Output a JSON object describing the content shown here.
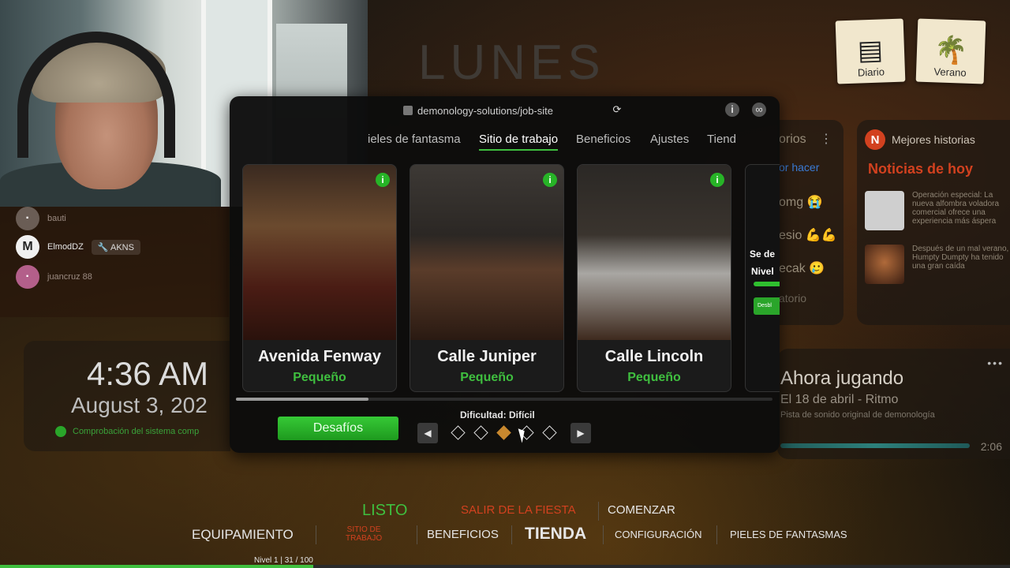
{
  "day_title": "LUNES",
  "top_cards": [
    {
      "label": "Diario",
      "icon": "newspaper-icon",
      "glyph": "▤"
    },
    {
      "label": "Verano",
      "icon": "palm-tree-icon",
      "glyph": "🌴"
    }
  ],
  "chat": {
    "messages": [
      {
        "name": "bauti",
        "avatar": "·",
        "badge": ""
      },
      {
        "name": "ElmodDZ",
        "avatar": "M",
        "badge": "🔧 AKNS"
      },
      {
        "name": "juancruz 88",
        "avatar": "·",
        "badge": ""
      }
    ]
  },
  "clock": {
    "time": "4:36 AM",
    "date": "August 3, 202",
    "status": "Comprobación del sistema comp"
  },
  "browser": {
    "url": "demonology-solutions/job-site",
    "tabs": [
      "ieles de fantasma",
      "Sitio de trabajo",
      "Beneficios",
      "Ajustes",
      "Tiend"
    ],
    "active_tab": "Sitio de trabajo"
  },
  "job_sites": [
    {
      "name": "Avenida Fenway",
      "size": "Pequeño"
    },
    {
      "name": "Calle Juniper",
      "size": "Pequeño"
    },
    {
      "name": "Calle Lincoln",
      "size": "Pequeño"
    }
  ],
  "partial_card": {
    "line1": "Se de",
    "line2": "Nivel",
    "button": "Desbl"
  },
  "challenges_label": "Desafíos",
  "difficulty_label": "Dificultad: Difícil",
  "difficulty": {
    "selected_index": 2,
    "levels": 5
  },
  "stories_panel": {
    "lines": [
      "orios",
      "or hacer",
      "omg 😭",
      "esio 💪💪",
      "ecak 🥲",
      "atorio"
    ]
  },
  "news": {
    "header": "Mejores historias",
    "title": "Noticias de hoy",
    "items": [
      {
        "text": "Operación especial: La nueva alfombra voladora comercial ofrece una experiencia más áspera"
      },
      {
        "text": "Después de un mal verano, Humpty Dumpty ha tenido una gran caída"
      }
    ]
  },
  "now_playing": {
    "title": "Ahora jugando",
    "track": "El 18 de abril - Ritmo",
    "description": "Pista de sonido original de demonología",
    "time": "2:06"
  },
  "bottom_menu": {
    "ready": "LISTO",
    "leave": "SALIR DE LA FIESTA",
    "start": "COMENZAR",
    "equipment": "EQUIPAMIENTO",
    "job_site_line1": "SITIO DE",
    "job_site_line2": "TRABAJO",
    "perks": "BENEFICIOS",
    "store": "TIENDA",
    "config": "CONFIGURACIÓN",
    "skins": "PIELES DE FANTASMAS"
  },
  "level": {
    "text": "Nivel 1 | 31 / 100",
    "progress": 0.31
  },
  "colors": {
    "accent_green": "#3fbf3f",
    "accent_red": "#d2411f",
    "diamond_selected": "#c8882e"
  }
}
